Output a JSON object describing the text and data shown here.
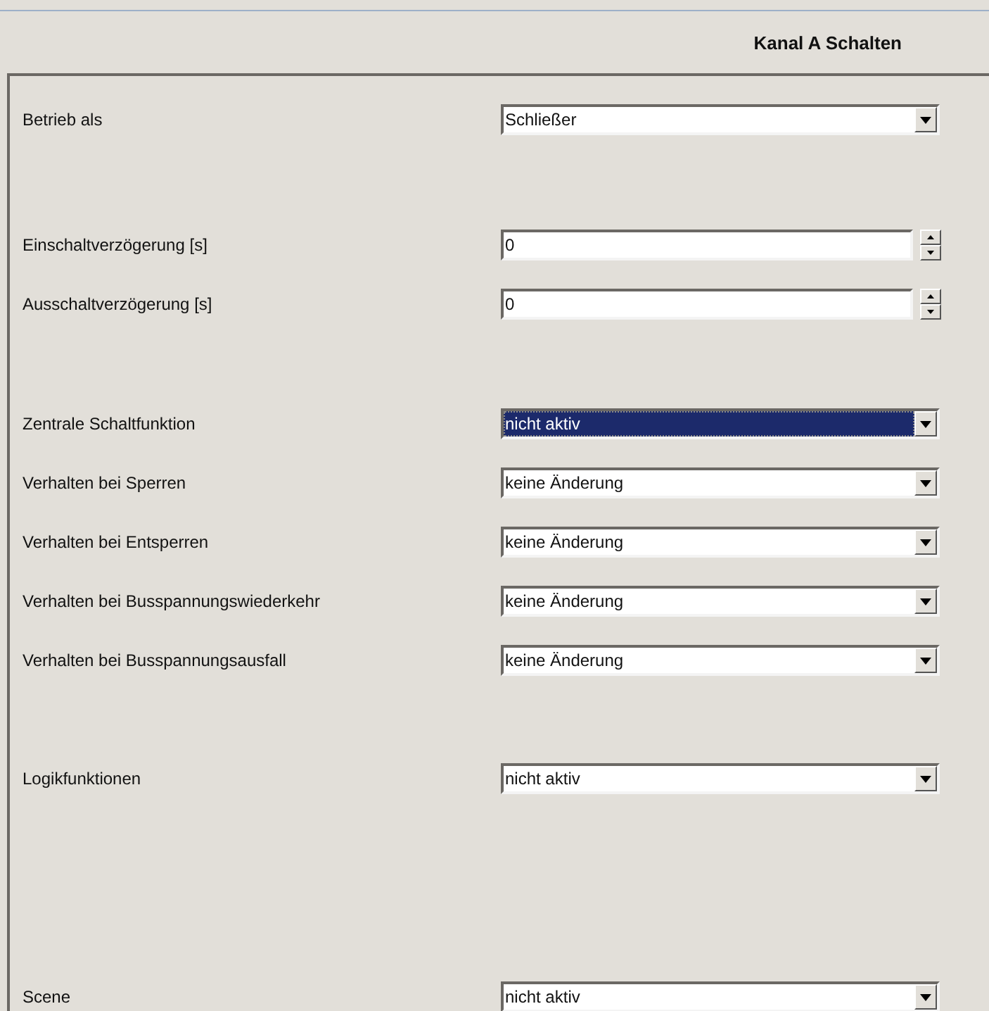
{
  "header": {
    "title": "Kanal A Schalten"
  },
  "groups": [
    {
      "rows": [
        {
          "kind": "dropdown",
          "label": "Betrieb als",
          "value": "Schließer",
          "selected": false
        }
      ]
    },
    {
      "rows": [
        {
          "kind": "spin",
          "label": "Einschaltverzögerung [s]",
          "value": "0"
        },
        {
          "kind": "spin",
          "label": "Ausschaltverzögerung [s]",
          "value": "0"
        }
      ]
    },
    {
      "rows": [
        {
          "kind": "dropdown",
          "label": "Zentrale Schaltfunktion",
          "value": "nicht aktiv",
          "selected": true
        },
        {
          "kind": "dropdown",
          "label": "Verhalten bei Sperren",
          "value": "keine Änderung",
          "selected": false
        },
        {
          "kind": "dropdown",
          "label": "Verhalten bei Entsperren",
          "value": "keine Änderung",
          "selected": false
        },
        {
          "kind": "dropdown",
          "label": "Verhalten bei Busspannungswiederkehr",
          "value": "keine Änderung",
          "selected": false
        },
        {
          "kind": "dropdown",
          "label": "Verhalten bei Busspannungsausfall",
          "value": "keine Änderung",
          "selected": false
        }
      ]
    },
    {
      "rows": [
        {
          "kind": "dropdown",
          "label": "Logikfunktionen",
          "value": "nicht aktiv",
          "selected": false
        }
      ]
    },
    {
      "rows": [
        {
          "kind": "dropdown",
          "label": "Scene",
          "value": "nicht aktiv",
          "selected": false
        }
      ]
    }
  ]
}
